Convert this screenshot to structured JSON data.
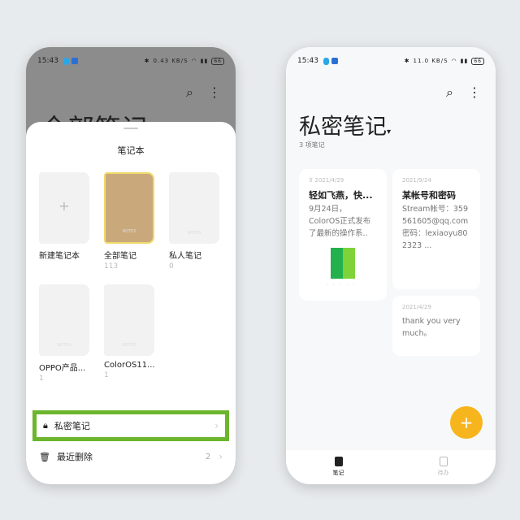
{
  "left": {
    "status": {
      "time": "15:43",
      "speed": "0.43 KB/S",
      "battery": "66"
    },
    "title": "全部笔记",
    "sheet": {
      "title": "笔记本",
      "notebooks": [
        {
          "name": "新建笔记本",
          "count": ""
        },
        {
          "name": "全部笔记",
          "count": "113"
        },
        {
          "name": "私人笔记",
          "count": "0"
        },
        {
          "name": "OPPO产品...",
          "count": "1"
        },
        {
          "name": "ColorOS11...",
          "count": "1"
        }
      ],
      "cover_label": "NOTES",
      "private": {
        "label": "私密笔记"
      },
      "trash": {
        "label": "最近删除",
        "count": "2"
      }
    }
  },
  "right": {
    "status": {
      "time": "15:43",
      "speed": "11.0 KB/S",
      "battery": "66"
    },
    "title": "私密笔记",
    "subtitle": "3 项笔记",
    "notes": [
      {
        "date": "2021/4/29",
        "title": "轻如飞燕，快...",
        "body": "9月24日，ColorOS正式发布了最新的操作系..",
        "pinned": true
      },
      {
        "date": "2021/9/24",
        "title": "某帐号和密码",
        "body": "Stream帐号：359561605@qq.com 密码：lexiaoyu802323 ..."
      },
      {
        "date": "2021/4/29",
        "title": "",
        "body": "thank you very much。"
      }
    ],
    "fab": "+",
    "tabs": [
      {
        "label": "笔记",
        "active": true
      },
      {
        "label": "待办",
        "active": false
      }
    ]
  },
  "colors": {
    "accent": "#f7b51d",
    "highlight": "#6cb52d"
  }
}
